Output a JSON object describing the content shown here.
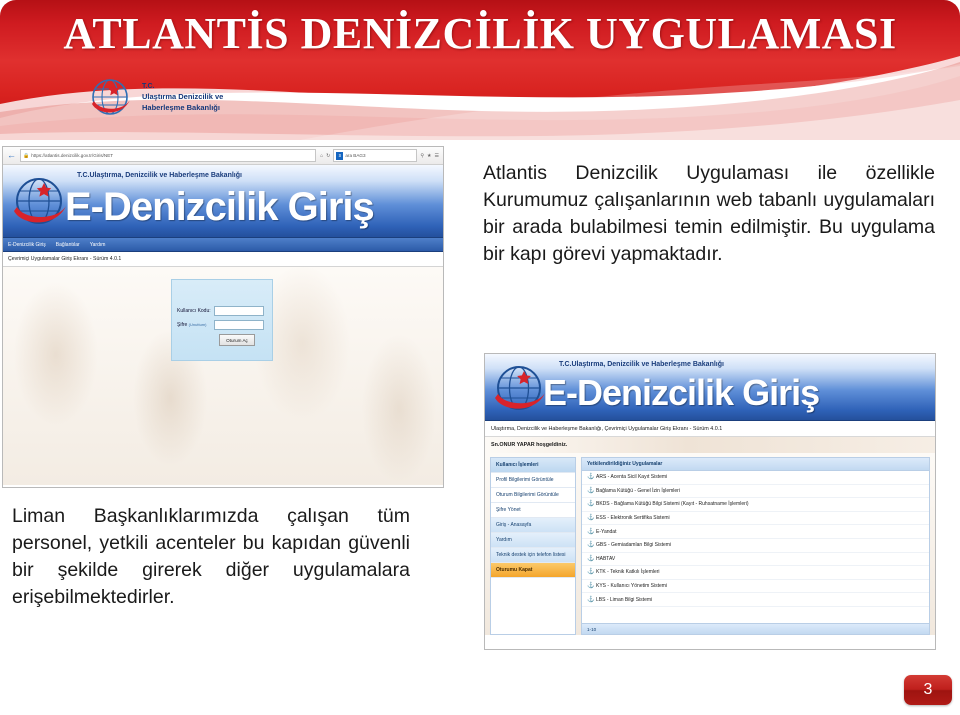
{
  "slide": {
    "banner_title": "ATLANTİS DENİZCİLİK UYGULAMASI",
    "page_number": "3",
    "accent_red": "#cf1b20",
    "accent_blue": "#2f62b8",
    "accent_orange": "#f4a52c"
  },
  "ministry_logo": {
    "tc": "T.C.",
    "line1": "Ulaştırma Denizcilik ve",
    "line2": "Haberleşme Bakanlığı",
    "icon": "globe-crescent-star-icon"
  },
  "paragraphs": {
    "right": "Atlantis Denizcilik Uygulaması ile özellikle Kurumumuz çalışanlarının web tabanlı uygulamaları bir arada bulabilmesi temin edilmiştir. Bu uygulama bir kapı görevi yapmaktadır.",
    "left": "Liman Başkanlıklarımızda çalışan tüm personel, yetkili acenteler bu kapıdan güvenli bir şekilde girerek diğer uygulamalara erişebilmektedirler."
  },
  "screenshot_login": {
    "browser": {
      "back_icon": "back-arrow-icon",
      "lock_icon": "lock-icon",
      "url": "https://atlantis.denizcilik.gov.tr/Giris/NET",
      "home_icon": "home-icon",
      "refresh_icon": "refresh-icon",
      "search_engine": "s",
      "search_value": "ara BAG3",
      "search_icon": "search-icon",
      "favorites_icon": "favorites-icon",
      "menu_icon": "menu-icon"
    },
    "header": {
      "ministry_line": "T.C.Ulaştırma, Denizcilik ve Haberleşme Bakanlığı",
      "title": "E-Denizcilik Giriş",
      "globe_icon": "globe-crescent-star-icon"
    },
    "nav": [
      "E-Denizcilik Giriş",
      "Bağlantılar",
      "Yardım"
    ],
    "subtitle": "Çevrimiçi Uygulamalar Giriş Ekranı - Sürüm 4.0.1",
    "login_form": {
      "user_label": "Kullanıcı Kodu:",
      "user_value": "",
      "pass_label": "Şifre",
      "pass_forgot": "(Unuttum)",
      "pass_value": "",
      "submit_label": "Oturum Aç"
    }
  },
  "screenshot_portal": {
    "header": {
      "ministry_line": "T.C.Ulaştırma, Denizcilik ve Haberleşme Bakanlığı",
      "title": "E-Denizcilik Giriş",
      "globe_icon": "globe-crescent-star-icon"
    },
    "subtitle": "Ulaştırma, Denizcilik ve Haberleşme Bakanlığı, Çevrimiçi Uygulamalar Giriş Ekranı - Sürüm 4.0.1",
    "welcome": "Sn.ONUR YAPAR hoşgeldiniz.",
    "sidebar": [
      {
        "label": "Kullanıcı İşlemleri",
        "kind": "head"
      },
      {
        "label": "Profil Bilgilerimi Görüntüle",
        "kind": "item"
      },
      {
        "label": "Oturum Bilgilerimi Görüntüle",
        "kind": "item"
      },
      {
        "label": "Şifre Yönet",
        "kind": "item"
      },
      {
        "label": "Giriş - Anasayfa",
        "kind": "group"
      },
      {
        "label": "Yardım",
        "kind": "group"
      },
      {
        "label": "Teknik destek için telefon listesi",
        "kind": "group"
      },
      {
        "label": "Oturumu Kapat",
        "kind": "logout"
      }
    ],
    "list_header": "Yetkilendirildiğiniz Uygulamalar",
    "applications": [
      "ARS - Acenta Sicil Kayıt Sistemi",
      "Bağlama Kütüğü - Genel İzin İşlemleri",
      "BKDS - Bağlama Kütüğü Bilgi Sistemi (Kayıt - Ruhsatname İşlemleri)",
      "ESS - Elektronik Sertifika Sistemi",
      "E-Yandat",
      "GBS - Gemiadamları Bilgi Sistemi",
      "HABTAV",
      "KTK - Teknik Katkılı İşlemleri",
      "KYS - Kullanıcı Yönetim Sistemi",
      "LBS - Liman Bilgi Sistemi"
    ],
    "list_footer": "1-10",
    "item_icon": "anchor-icon"
  }
}
